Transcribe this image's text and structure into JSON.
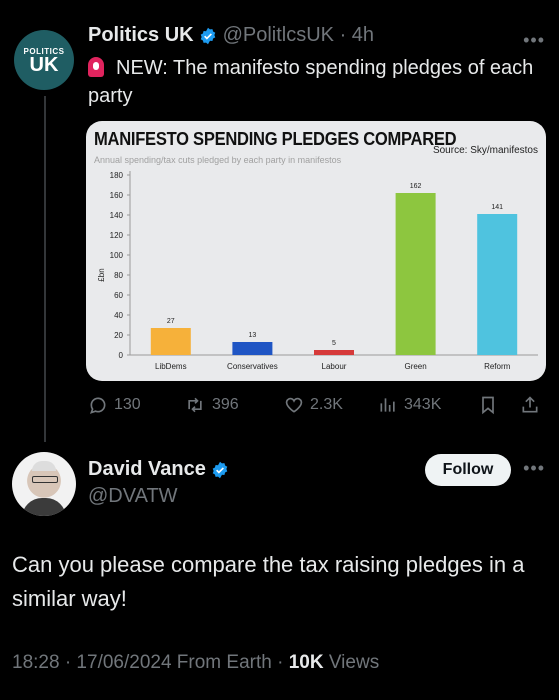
{
  "tweet": {
    "avatar_text_top": "POLITICS",
    "avatar_text_bottom": "UK",
    "author": "Politics UK",
    "handle": "@PolitlcsUK",
    "time": "4h",
    "siren_icon": "siren-icon",
    "text": "NEW: The manifesto spending pledges of each party",
    "actions": {
      "replies": "130",
      "retweets": "396",
      "likes": "2.3K",
      "views": "343K"
    }
  },
  "chart_data": {
    "type": "bar",
    "title": "MANIFESTO SPENDING PLEDGES COMPARED",
    "subtitle": "Annual spending/tax cuts pledged by each party in manifestos",
    "source": "Source: Sky/manifestos",
    "ylabel": "£bn",
    "xlabel": "",
    "ylim": [
      0,
      180
    ],
    "yticks": [
      0,
      20,
      40,
      60,
      80,
      100,
      120,
      140,
      160,
      180
    ],
    "grid": false,
    "categories": [
      "LibDems",
      "Conservatives",
      "Labour",
      "Green",
      "Reform"
    ],
    "values": [
      27,
      13,
      5,
      162,
      141
    ],
    "colors": [
      "#f6b13a",
      "#1f55c4",
      "#d63a3a",
      "#8dc63f",
      "#4fc3df"
    ]
  },
  "reply": {
    "author": "David Vance",
    "handle": "@DVATW",
    "follow_label": "Follow",
    "text": "Can you please compare the tax raising pledges in a similar way!",
    "time": "18:28 · 17/06/2024 From Earth · ",
    "views_count": "10K",
    "views_label": " Views"
  },
  "colors": {
    "background": "#000000",
    "text": "#e7e9ea",
    "muted": "#71767b",
    "verified": "#1d9bf0"
  }
}
